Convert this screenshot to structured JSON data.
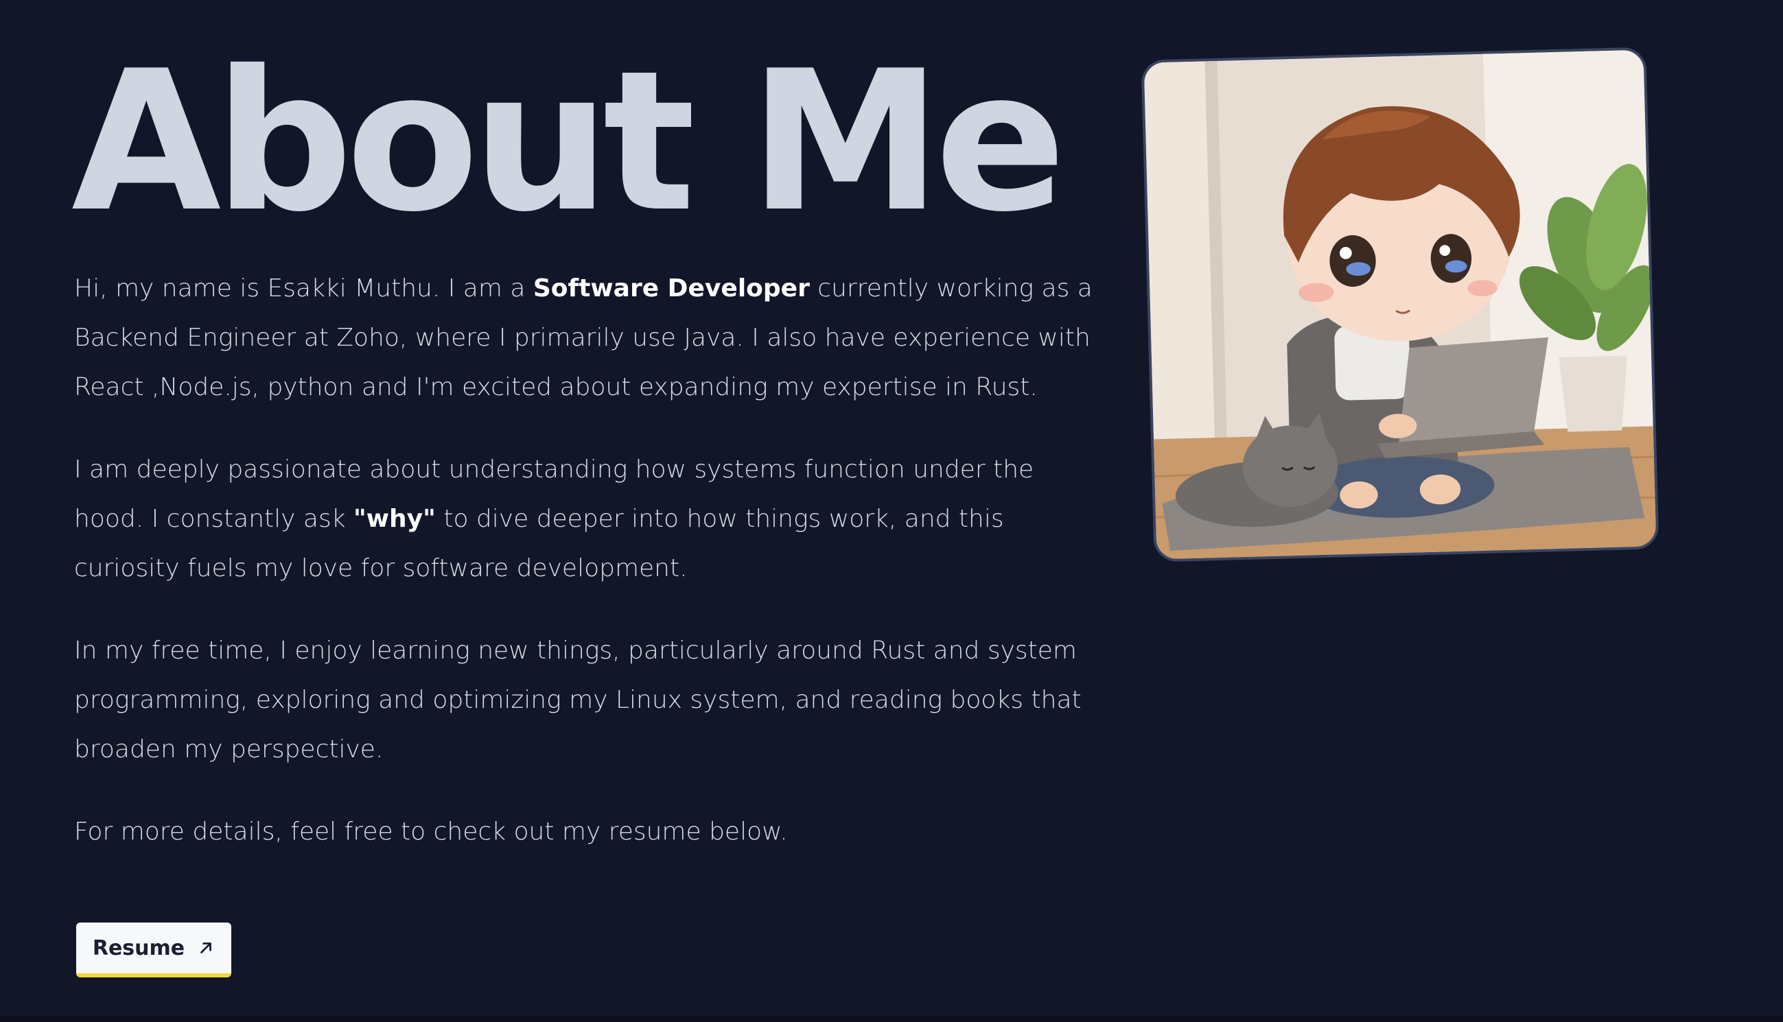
{
  "heading": "About Me",
  "intro": {
    "part1": "Hi, my name is Esakki Muthu. I am a ",
    "bold": "Software Developer",
    "part2": " currently working as a Backend Engineer at Zoho, where I primarily use Java. I also have experience with React ,Node.js, python and I'm excited about expanding my expertise in Rust."
  },
  "passion": {
    "part1": "I am deeply passionate about understanding how systems function under the hood. I constantly ask ",
    "bold": "\"why\"",
    "part2": " to dive deeper into how things work, and this curiosity fuels my love for software development."
  },
  "free_time": "In my free time, I enjoy learning new things, particularly around Rust and system programming, exploring and optimizing my Linux system, and reading books that broaden my perspective.",
  "more_details": "For more details, feel free to check out my resume below.",
  "resume_button": {
    "label": "Resume",
    "icon": "arrow-up-right-icon"
  },
  "profile_image": {
    "alt": "Cartoon boy with laptop and cat"
  },
  "colors": {
    "background": "#111629",
    "heading": "#cfd5e1",
    "body_text": "#d9dde6",
    "button_bg": "#f7f8fb",
    "button_accent": "#f2d542"
  }
}
